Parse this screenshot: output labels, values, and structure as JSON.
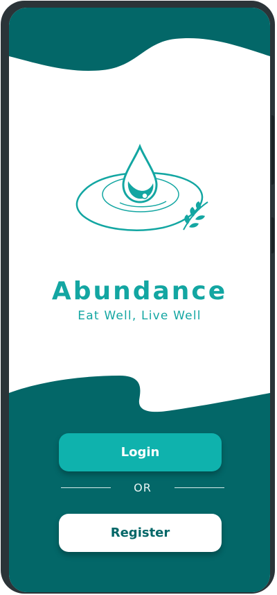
{
  "app": {
    "name": "Abundance",
    "tagline": "Eat Well, Live Well"
  },
  "actions": {
    "login_label": "Login",
    "divider_label": "OR",
    "register_label": "Register"
  },
  "icons": {
    "logo": "water-drop-ripple-leaf-icon"
  },
  "colors": {
    "primary_dark": "#036768",
    "accent": "#13a6a2",
    "button_primary": "#0fb2ad",
    "background": "#ffffff"
  }
}
